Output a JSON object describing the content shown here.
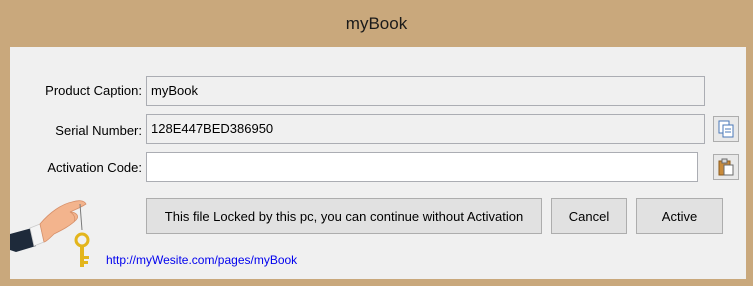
{
  "window": {
    "title": "myBook"
  },
  "form": {
    "product_caption_label": "Product Caption:",
    "product_caption_value": "myBook",
    "serial_number_label": "Serial Number:",
    "serial_number_value": "128E447BED386950",
    "activation_code_label": "Activation Code:",
    "activation_code_value": ""
  },
  "buttons": {
    "continue_label": "This file Locked by this pc, you can continue without Activation",
    "cancel_label": "Cancel",
    "active_label": "Active"
  },
  "link": {
    "text": "http://myWesite.com/pages/myBook"
  },
  "icons": {
    "copy": "copy-icon",
    "paste": "paste-icon",
    "illustration": "hand-holding-key-icon"
  },
  "colors": {
    "titlebar": "#c9a87c",
    "client": "#f0f0f0",
    "link": "#0000ee"
  }
}
